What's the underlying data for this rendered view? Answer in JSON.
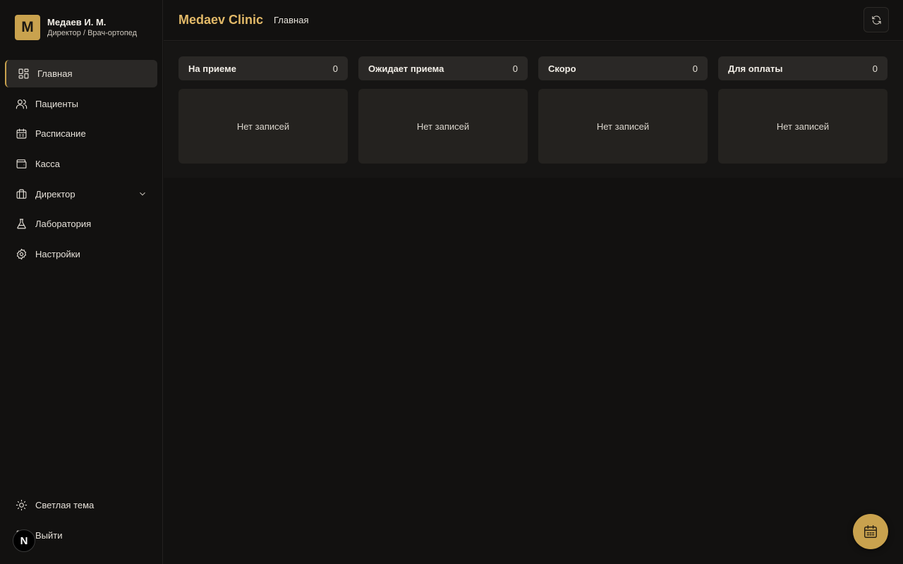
{
  "user": {
    "avatar_letter": "M",
    "name": "Медаев И. М.",
    "role": "Директор / Врач-ортопед"
  },
  "sidebar": {
    "items": [
      {
        "label": "Главная",
        "icon": "dashboard-icon",
        "active": true
      },
      {
        "label": "Пациенты",
        "icon": "users-icon"
      },
      {
        "label": "Расписание",
        "icon": "calendar-icon"
      },
      {
        "label": "Касса",
        "icon": "wallet-icon"
      },
      {
        "label": "Директор",
        "icon": "briefcase-icon",
        "expandable": true
      },
      {
        "label": "Лаборатория",
        "icon": "flask-icon"
      },
      {
        "label": "Настройки",
        "icon": "gear-icon"
      }
    ],
    "bottom": [
      {
        "label": "Светлая тема",
        "icon": "sun-icon"
      },
      {
        "label": "Выйти",
        "icon": "logout-icon"
      }
    ]
  },
  "header": {
    "brand": "Medaev Clinic",
    "breadcrumb": "Главная"
  },
  "board": {
    "columns": [
      {
        "title": "На приеме",
        "count": "0",
        "empty_text": "Нет записей"
      },
      {
        "title": "Ожидает приема",
        "count": "0",
        "empty_text": "Нет записей"
      },
      {
        "title": "Скоро",
        "count": "0",
        "empty_text": "Нет записей"
      },
      {
        "title": "Для оплаты",
        "count": "0",
        "empty_text": "Нет записей"
      }
    ]
  },
  "badge": {
    "letter": "N"
  },
  "colors": {
    "accent": "#c9a24e",
    "brand_text": "#e2b968",
    "background": "#121110",
    "card": "#24221f"
  }
}
